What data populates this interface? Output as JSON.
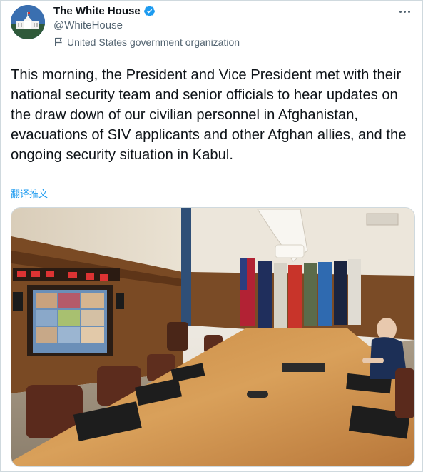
{
  "account": {
    "name": "The White House",
    "handle": "@WhiteHouse",
    "label": "United States government organization",
    "verified_icon": "verified-badge-icon",
    "label_icon": "flag-icon"
  },
  "tweet": {
    "text": "This morning, the President and Vice President met with their national security team and senior officials to hear updates on the draw down of our civilian personnel in Afghanistan, evacuations of SIV applicants and other Afghan allies, and the ongoing security situation in Kabul.",
    "translate_label": "翻译推文"
  },
  "colors": {
    "accent": "#1d9bf0",
    "text": "#0f1419",
    "secondary": "#536471"
  }
}
